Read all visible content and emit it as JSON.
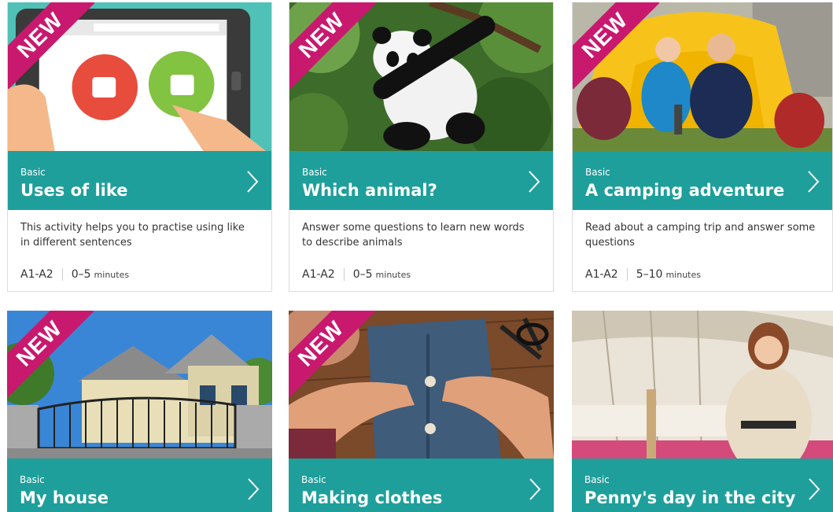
{
  "ribbon_label": "NEW",
  "colors": {
    "band": "#1e9f9b",
    "ribbon": "#c8196e"
  },
  "cards": [
    {
      "level": "Basic",
      "title": "Uses of like",
      "new": true,
      "image": "tablet-thumbs-illustration",
      "description": "This activity helps you to practise using like in different sentences",
      "cefr": "A1-A2",
      "duration": "0–5",
      "unit": "minutes"
    },
    {
      "level": "Basic",
      "title": "Which animal?",
      "new": true,
      "image": "panda-in-tree-photo",
      "description": "Answer some questions to learn new words to describe animals",
      "cefr": "A1-A2",
      "duration": "0–5",
      "unit": "minutes"
    },
    {
      "level": "Basic",
      "title": "A camping adventure",
      "new": true,
      "image": "couple-in-tent-photo",
      "description": "Read about a camping trip and answer some questions",
      "cefr": "A1-A2",
      "duration": "5–10",
      "unit": "minutes"
    },
    {
      "level": "Basic",
      "title": "My house",
      "new": true,
      "image": "house-with-gate-photo"
    },
    {
      "level": "Basic",
      "title": "Making clothes",
      "new": true,
      "image": "sewing-button-photo"
    },
    {
      "level": "Basic",
      "title": "Penny's day in the city",
      "new": false,
      "image": "woman-in-station-photo"
    }
  ]
}
